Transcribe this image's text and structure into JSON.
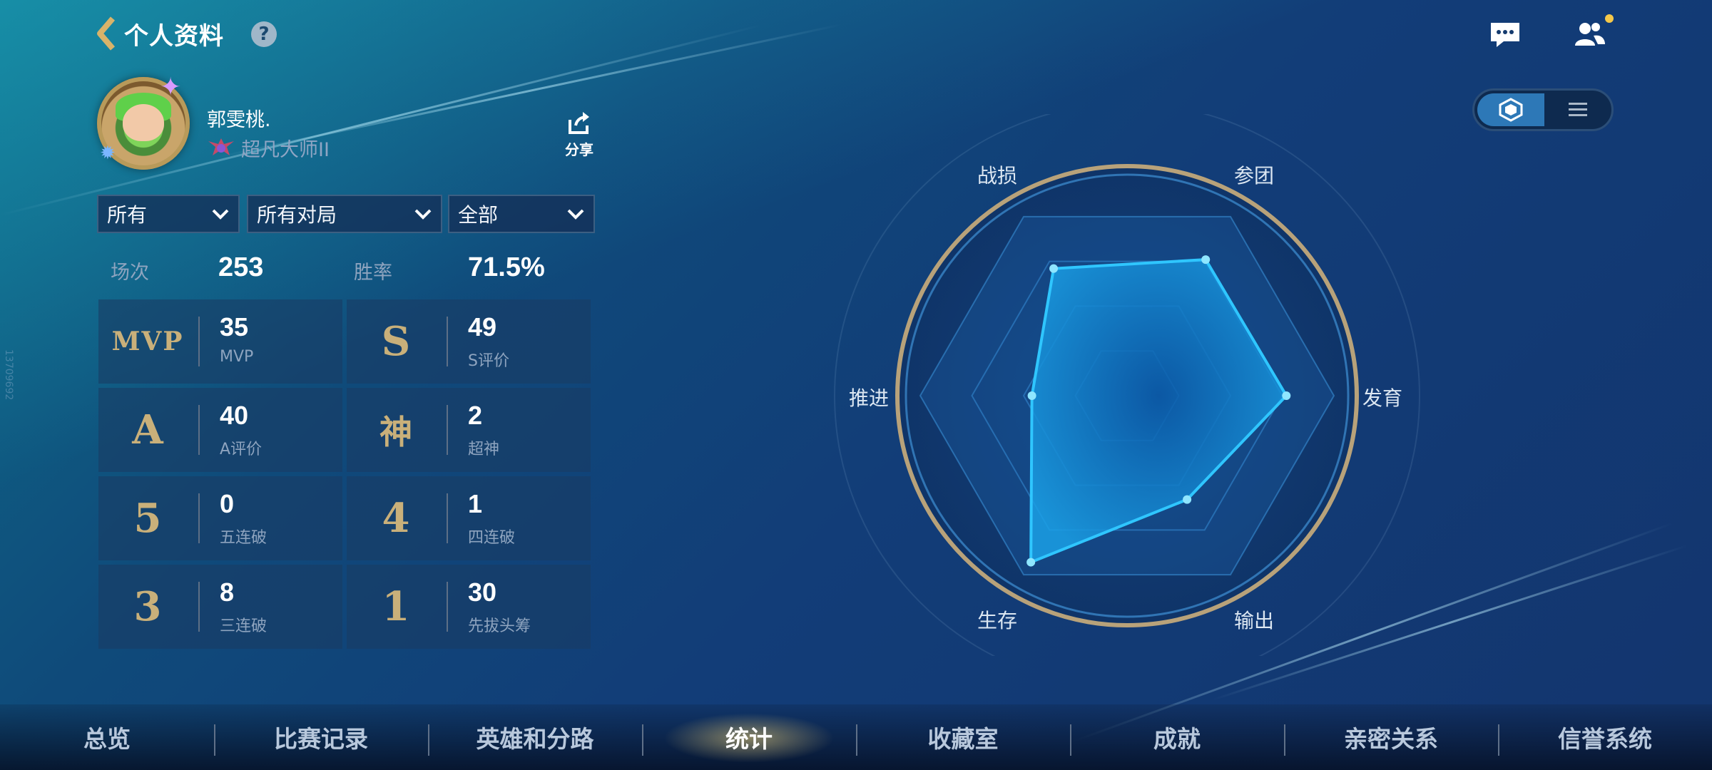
{
  "header": {
    "title": "个人资料",
    "help_icon": "?"
  },
  "profile": {
    "name": "郭雯桃.",
    "rank": "超凡大师II",
    "share_label": "分享"
  },
  "filters": [
    {
      "value": "所有"
    },
    {
      "value": "所有对局"
    },
    {
      "value": "全部"
    }
  ],
  "summary": {
    "matches_label": "场次",
    "matches_value": "253",
    "winrate_label": "胜率",
    "winrate_value": "71.5%"
  },
  "achievements": [
    {
      "badge": "MVP",
      "value": "35",
      "label": "MVP"
    },
    {
      "badge": "S",
      "value": "49",
      "label": "S评价"
    },
    {
      "badge": "A",
      "value": "40",
      "label": "A评价"
    },
    {
      "badge": "神",
      "value": "2",
      "label": "超神"
    },
    {
      "badge": "5",
      "value": "0",
      "label": "五连破"
    },
    {
      "badge": "4",
      "value": "1",
      "label": "四连破"
    },
    {
      "badge": "3",
      "value": "8",
      "label": "三连破"
    },
    {
      "badge": "1",
      "value": "30",
      "label": "先拔头筹"
    }
  ],
  "radar": {
    "axes": [
      "战损",
      "参团",
      "发育",
      "输出",
      "生存",
      "推进"
    ],
    "values": [
      0.71,
      0.76,
      0.77,
      0.58,
      0.93,
      0.46
    ]
  },
  "nav": {
    "items": [
      "总览",
      "比赛记录",
      "英雄和分路",
      "统计",
      "收藏室",
      "成就",
      "亲密关系",
      "信誉系统"
    ],
    "active": "统计"
  },
  "side_id": "13709692",
  "colors": {
    "accent": "#2fc6ff",
    "gold": "#c9b07a"
  }
}
